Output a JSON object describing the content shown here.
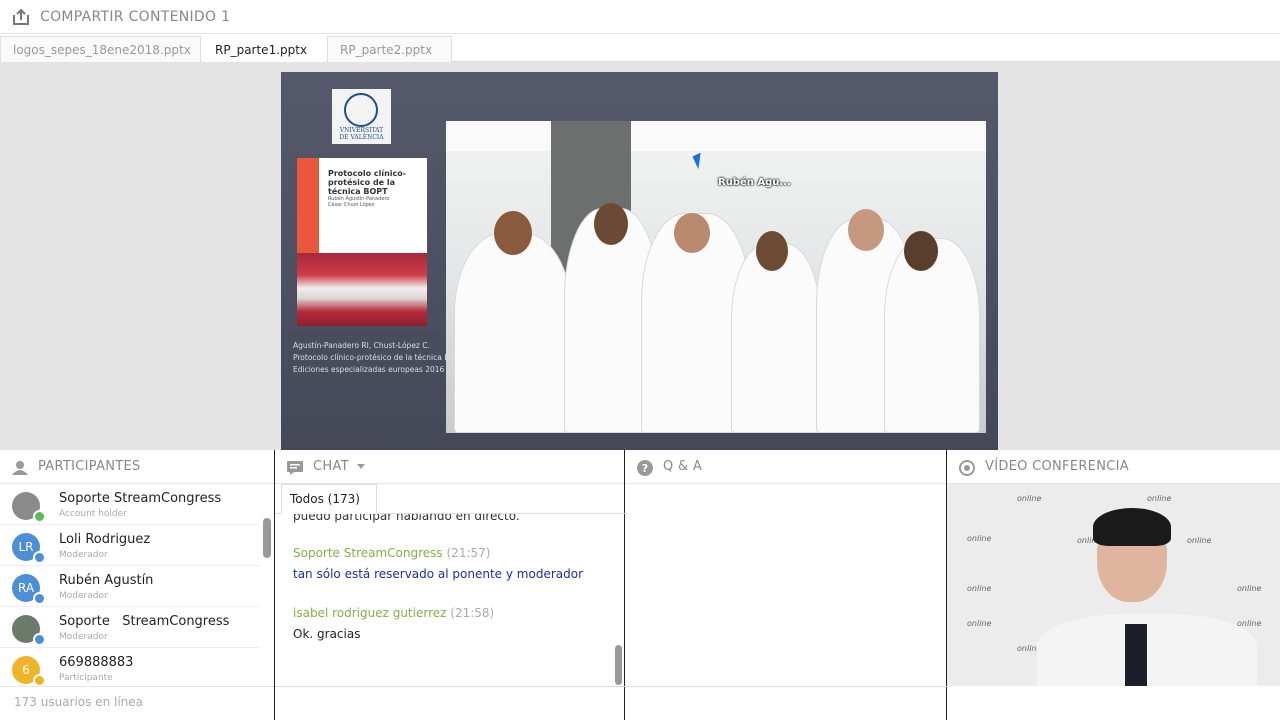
{
  "header": {
    "title": "COMPARTIR CONTENIDO 1",
    "icon": "upload-icon"
  },
  "tabs": [
    {
      "label": "logos_sepes_18ene2018.pptx",
      "active": false
    },
    {
      "label": "RP_parte1.pptx",
      "active": true
    },
    {
      "label": "RP_parte2.pptx",
      "active": false
    }
  ],
  "slide": {
    "logo_text": "VNIVERSITAT\nDE VALÈNCIA",
    "book_title": "Protocolo clínico-protésico de la técnica BOPT",
    "book_authors": "Rubén Agustín-Panadero\nCésar Chust López",
    "caption": "Agustín-Panadero RI, Chust-López C.\nProtocolo clínico-protésico de la técnica BOPT.\nEdiciones especializadas europeas 2016",
    "cursor_label": "Rubén Agu..."
  },
  "participants": {
    "title": "PARTICIPANTES",
    "icon": "person-icon",
    "items": [
      {
        "name": "Soporte StreamCongress",
        "role": "Account holder",
        "initials": "",
        "color": "#8a8a8a",
        "badge": "#5cb85c"
      },
      {
        "name": "Loli Rodriguez",
        "role": "Moderador",
        "initials": "LR",
        "color": "#4d8fd6",
        "badge": "#4d8fd6"
      },
      {
        "name": "Rubén Agustín",
        "role": "Moderador",
        "initials": "RA",
        "color": "#4d8fd6",
        "badge": "#4d8fd6"
      },
      {
        "name": "Soporte   StreamCongress",
        "role": "Moderador",
        "initials": "",
        "color": "#6c7a6c",
        "badge": "#4d8fd6"
      },
      {
        "name": "669888883",
        "role": "Participante",
        "initials": "6",
        "color": "#f0b429",
        "badge": "#f0b429"
      }
    ],
    "footer": "173 usuarios en línea"
  },
  "chat": {
    "title": "CHAT",
    "icon": "chat-icon",
    "tab": "Todos (173)",
    "messages": [
      {
        "text": "puedo participar hablando en directo."
      },
      {
        "who": "Soporte StreamCongress",
        "time": "(21:57)",
        "text": "tan sólo está reservado al ponente y moderador",
        "text_color": "#1b2fa0"
      },
      {
        "who": "isabel rodriguez gutierrez",
        "time": "(21:58)",
        "text": "Ok. gracias",
        "text_color": "#222"
      }
    ]
  },
  "qa": {
    "title": "Q & A",
    "icon": "question-icon"
  },
  "video": {
    "title": "VÍDEO CONFERENCIA",
    "icon": "camera-icon",
    "watermark": "online"
  }
}
